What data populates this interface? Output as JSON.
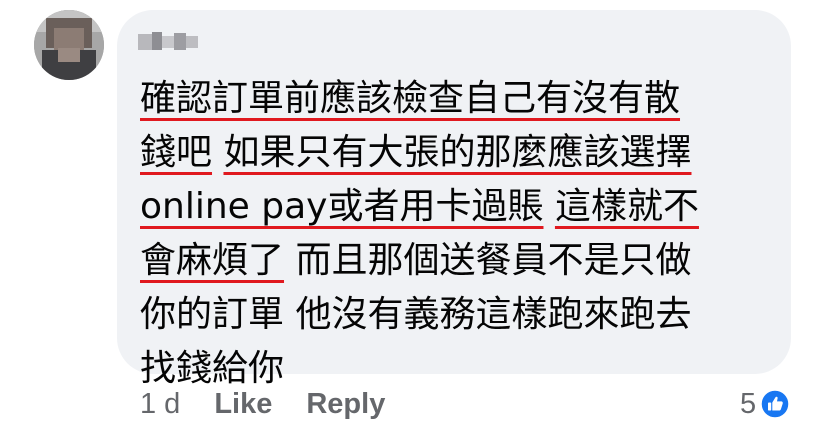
{
  "comment": {
    "lines": [
      [
        {
          "text": "確認訂單前應該檢查自己有沒有散",
          "underlined": true
        }
      ],
      [
        {
          "text": "錢吧",
          "underlined": true
        },
        {
          "text": " ",
          "underlined": false
        },
        {
          "text": "如果只有大張的那麼應該選擇",
          "underlined": true
        }
      ],
      [
        {
          "text": "online pay或者用卡過賬",
          "underlined": true
        },
        {
          "text": " ",
          "underlined": false
        },
        {
          "text": "這樣就不",
          "underlined": true
        }
      ],
      [
        {
          "text": "會麻煩了",
          "underlined": true
        },
        {
          "text": " 而且那個送餐員不是只做",
          "underlined": false
        }
      ],
      [
        {
          "text": "你的訂單 他沒有義務這樣跑來跑去",
          "underlined": false
        }
      ],
      [
        {
          "text": "找錢給你",
          "underlined": false
        }
      ]
    ]
  },
  "actions": {
    "timestamp": "1 d",
    "like_label": "Like",
    "reply_label": "Reply"
  },
  "reactions": {
    "count": "5",
    "icon": "like-thumbs-up-icon"
  },
  "colors": {
    "bubble_bg": "#f0f2f5",
    "text": "#050505",
    "meta": "#65676b",
    "underline": "#e0191f",
    "like_blue": "#1877f2"
  }
}
